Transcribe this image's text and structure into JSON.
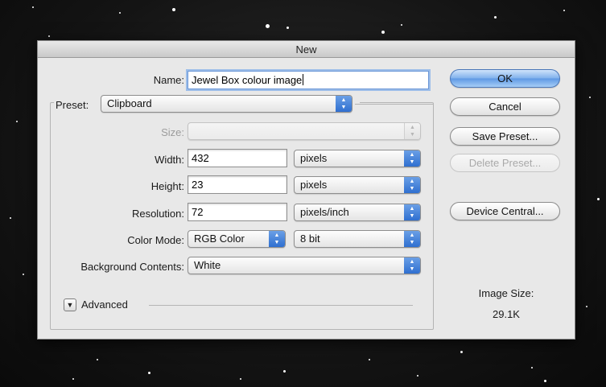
{
  "dialog": {
    "title": "New",
    "name_label": "Name:",
    "name_value": "Jewel Box colour image",
    "preset_label": "Preset:",
    "preset_value": "Clipboard",
    "size_label": "Size:",
    "size_value": "",
    "width_label": "Width:",
    "width_value": "432",
    "width_unit": "pixels",
    "height_label": "Height:",
    "height_value": "23",
    "height_unit": "pixels",
    "resolution_label": "Resolution:",
    "resolution_value": "72",
    "resolution_unit": "pixels/inch",
    "color_mode_label": "Color Mode:",
    "color_mode_value": "RGB Color",
    "bit_depth_value": "8 bit",
    "background_label": "Background Contents:",
    "background_value": "White",
    "advanced_label": "Advanced",
    "image_size_label": "Image Size:",
    "image_size_value": "29.1K"
  },
  "buttons": {
    "ok": "OK",
    "cancel": "Cancel",
    "save_preset": "Save Preset...",
    "delete_preset": "Delete Preset...",
    "device_central": "Device Central..."
  },
  "icons": {
    "popup_arrows": "updown-arrows-icon",
    "advanced_toggle": "triangle-down-icon"
  },
  "colors": {
    "accent": "#5e98e4",
    "dialog_bg": "#e8e8e8",
    "backdrop": "#141414"
  }
}
